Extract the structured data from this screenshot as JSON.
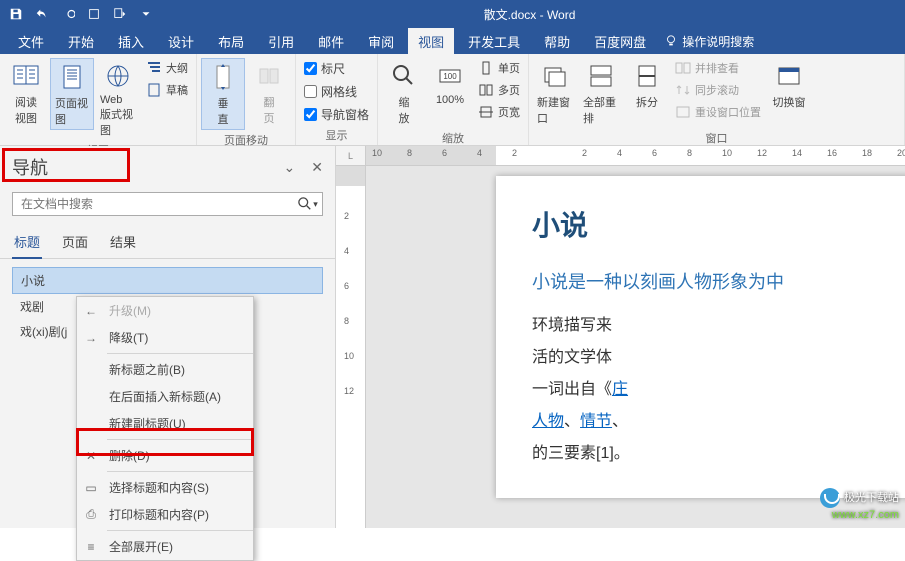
{
  "title": "散文.docx - Word",
  "qat": [
    "save",
    "undo",
    "redo",
    "touch",
    "q1",
    "q2",
    "more"
  ],
  "menu": {
    "items": [
      "文件",
      "开始",
      "插入",
      "设计",
      "布局",
      "引用",
      "邮件",
      "审阅",
      "视图",
      "开发工具",
      "帮助",
      "百度网盘"
    ],
    "active": "视图",
    "tellme": "操作说明搜索"
  },
  "ribbon": {
    "views": {
      "label": "视图",
      "read": "阅读\n视图",
      "page": "页面视图",
      "web": "Web 版式视图",
      "outline": "大纲",
      "draft": "草稿"
    },
    "move": {
      "label": "页面移动",
      "vert": "垂\n直",
      "flip": "翻\n页"
    },
    "show": {
      "label": "显示",
      "ruler": "标尺",
      "grid": "网格线",
      "nav": "导航窗格"
    },
    "zoom": {
      "label": "缩放",
      "zoom": "缩\n放",
      "p100": "100%",
      "one": "单页",
      "multi": "多页",
      "width": "页宽"
    },
    "window": {
      "label": "窗口",
      "new": "新建窗口",
      "all": "全部重排",
      "split": "拆分",
      "side": "并排查看",
      "sync": "同步滚动",
      "reset": "重设窗口位置",
      "switch": "切换窗"
    }
  },
  "nav": {
    "title": "导航",
    "searchPlaceholder": "在文档中搜索",
    "tabs": [
      "标题",
      "页面",
      "结果"
    ],
    "items": [
      "小说",
      "戏剧",
      "戏(xi)剧(j"
    ]
  },
  "contextMenu": [
    {
      "icon": "←",
      "label": "升级(M)",
      "disabled": true
    },
    {
      "icon": "→",
      "label": "降级(T)"
    },
    {
      "sep": true
    },
    {
      "icon": "",
      "label": "新标题之前(B)"
    },
    {
      "icon": "",
      "label": "在后面插入新标题(A)"
    },
    {
      "icon": "",
      "label": "新建副标题(U)"
    },
    {
      "sep": true
    },
    {
      "icon": "✕",
      "label": "删除(D)"
    },
    {
      "sep": true
    },
    {
      "icon": "▭",
      "label": "选择标题和内容(S)"
    },
    {
      "icon": "⎙",
      "label": "打印标题和内容(P)"
    },
    {
      "sep": true
    },
    {
      "icon": "≡",
      "label": "全部展开(E)"
    }
  ],
  "ruler": {
    "corner": "L",
    "hticks": [
      "10",
      "8",
      "6",
      "4",
      "2",
      "",
      "2",
      "4",
      "6",
      "8",
      "10",
      "12",
      "14",
      "16",
      "18",
      "20"
    ],
    "vticks": [
      "",
      "2",
      "4",
      "6",
      "8",
      "10",
      "12"
    ]
  },
  "doc": {
    "h1": "小说",
    "sub": "小说是一种以刻画人物形象为中",
    "body": "环境描写来\n活的文学体\n一词出自《|庄\n|人物|、|情节|、\n的三要素[1]。"
  },
  "watermark": {
    "line1": "极光下载站",
    "line2": "www.xz7.com"
  }
}
